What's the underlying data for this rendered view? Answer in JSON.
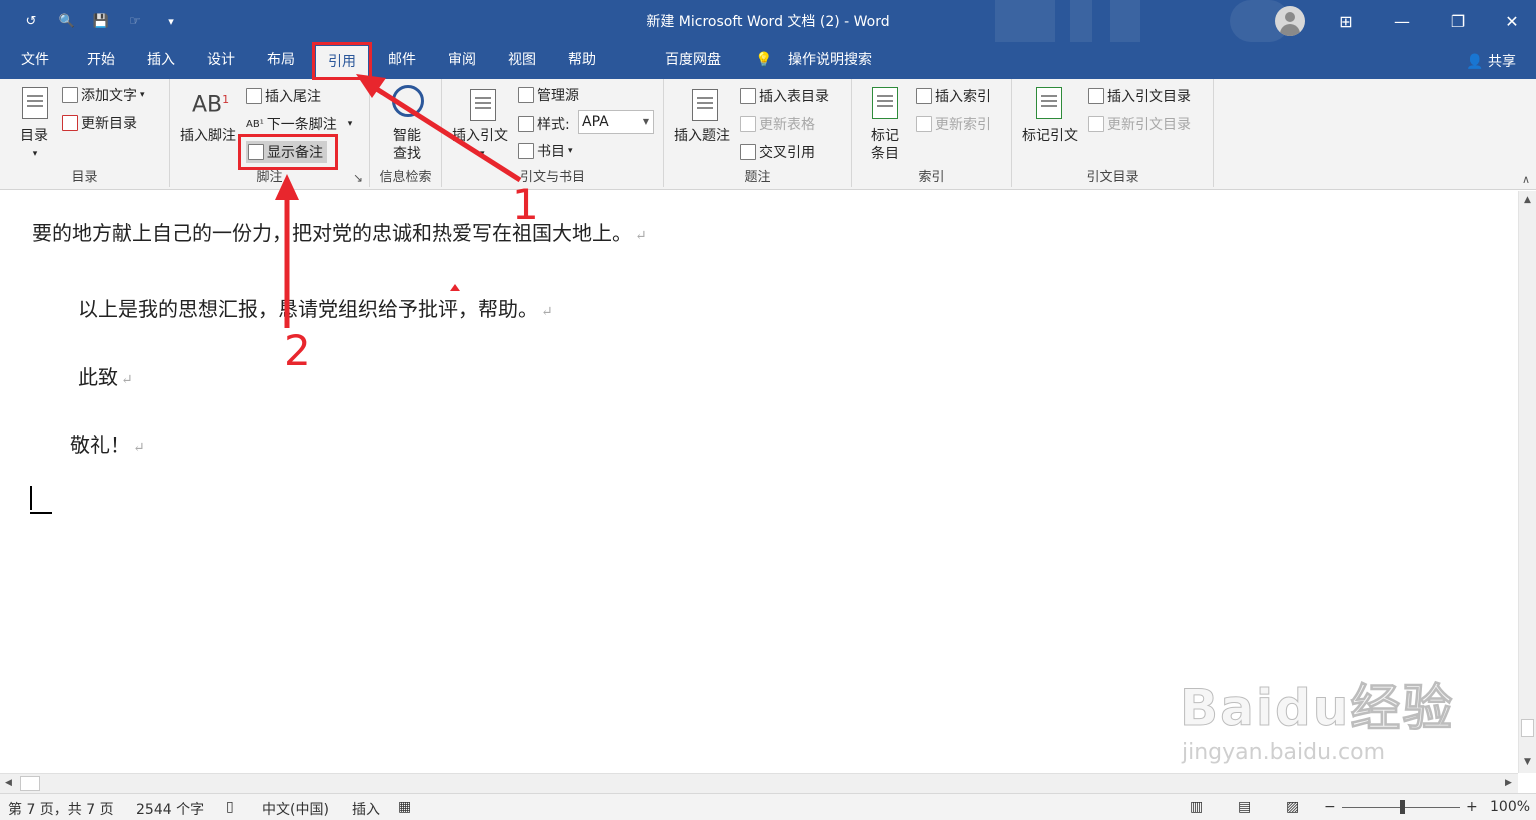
{
  "window": {
    "title": "新建 Microsoft Word 文档 (2)  -  Word",
    "controls": {
      "ribbon_display": "⊞",
      "minimize": "—",
      "restore": "❐",
      "close": "✕"
    }
  },
  "quick_access": {
    "undo": "↺",
    "print_preview": "🔍",
    "save": "💾",
    "touch": "☞",
    "customize": "▾"
  },
  "tabs": [
    {
      "label": "文件"
    },
    {
      "label": "开始"
    },
    {
      "label": "插入"
    },
    {
      "label": "设计"
    },
    {
      "label": "布局"
    },
    {
      "label": "引用",
      "active": true
    },
    {
      "label": "邮件"
    },
    {
      "label": "审阅"
    },
    {
      "label": "视图"
    },
    {
      "label": "帮助"
    },
    {
      "label": "百度网盘"
    },
    {
      "label": "操作说明搜索"
    }
  ],
  "share_label": "共享",
  "ribbon": {
    "toc": {
      "group_label": "目录",
      "toc_button": "目录",
      "add_text": "添加文字",
      "update_toc": "更新目录"
    },
    "footnotes": {
      "group_label": "脚注",
      "insert_footnote": "插入脚注",
      "insert_endnote": "插入尾注",
      "next_footnote": "下一条脚注",
      "show_notes": "显示备注",
      "ab_glyph": "AB",
      "ab_sup": "1"
    },
    "research": {
      "group_label": "信息检索",
      "smart_lookup_l1": "智能",
      "smart_lookup_l2": "查找"
    },
    "citations": {
      "group_label": "引文与书目",
      "insert_citation": "插入引文",
      "manage_sources": "管理源",
      "style_label": "样式:",
      "style_value": "APA",
      "bibliography": "书目"
    },
    "captions": {
      "group_label": "题注",
      "insert_caption": "插入题注",
      "insert_tof": "插入表目录",
      "update_table": "更新表格",
      "cross_reference": "交叉引用"
    },
    "index": {
      "group_label": "索引",
      "mark_entry_l1": "标记",
      "mark_entry_l2": "条目",
      "insert_index": "插入索引",
      "update_index": "更新索引"
    },
    "toa": {
      "group_label": "引文目录",
      "mark_citation": "标记引文",
      "insert_toa": "插入引文目录",
      "update_toa": "更新引文目录"
    }
  },
  "document": {
    "paragraphs": [
      "要的地方献上自己的一份力，把对党的忠诚和热爱写在祖国大地上。",
      "以上是我的思想汇报，恳请党组织给予批评，帮助。",
      "此致",
      "敬礼！"
    ],
    "para_mark": "↵"
  },
  "status_bar": {
    "page": "第 7 页，共 7 页",
    "words": "2544 个字",
    "language": "中文(中国)",
    "mode": "插入",
    "zoom": "100%",
    "zoom_value": 100
  },
  "annotations": {
    "step1": "1",
    "step2": "2"
  },
  "watermark": {
    "brand": "Baidu经验",
    "url": "jingyan.baidu.com"
  },
  "colors": {
    "accent": "#2b579a",
    "annotation": "#e8262d"
  }
}
